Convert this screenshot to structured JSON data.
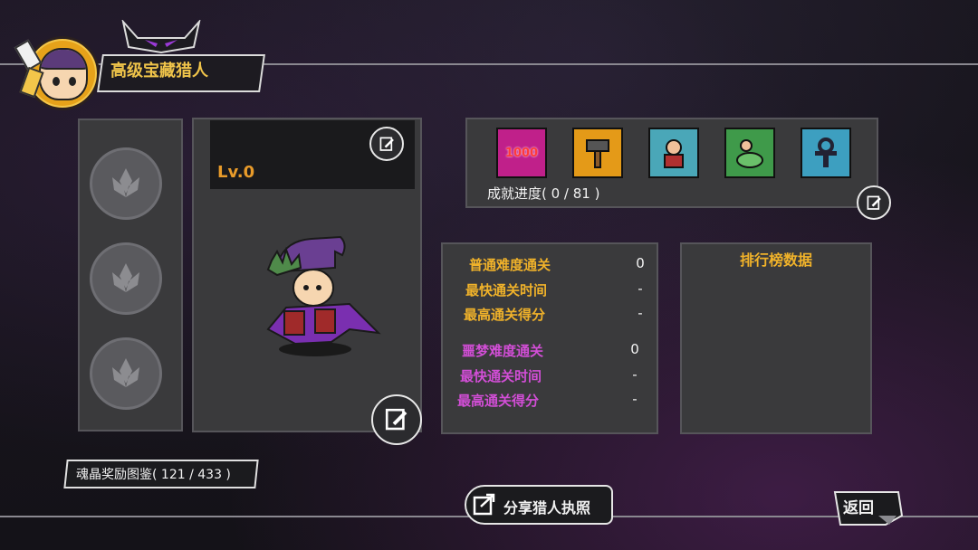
{
  "header": {
    "title": "高级宝藏猎人"
  },
  "character": {
    "level": "Lv.0"
  },
  "achievements": {
    "icons": [
      {
        "name": "1000-badge-icon",
        "label": "1000",
        "color": "#c0208a"
      },
      {
        "name": "hammer-icon",
        "label": "",
        "color": "#e49a18"
      },
      {
        "name": "fighter-icon",
        "label": "",
        "color": "#4aa7b8"
      },
      {
        "name": "dinosaur-rider-icon",
        "label": "",
        "color": "#3f9a4a"
      },
      {
        "name": "ankh-icon",
        "label": "",
        "color": "#3d9fc0"
      }
    ],
    "progress": "成就进度( 0 / 81 )"
  },
  "stats": {
    "normal": [
      {
        "label": "普通难度通关",
        "value": "0"
      },
      {
        "label": "最快通关时间",
        "value": "-"
      },
      {
        "label": "最高通关得分",
        "value": "-"
      }
    ],
    "nightmare": [
      {
        "label": "噩梦难度通关",
        "value": "0"
      },
      {
        "label": "最快通关时间",
        "value": "-"
      },
      {
        "label": "最高通关得分",
        "value": "-"
      }
    ]
  },
  "ranking": {
    "title": "排行榜数据"
  },
  "gallery": {
    "text": "魂晶奖励图鉴( 121 / 433 )"
  },
  "buttons": {
    "share": "分享猎人执照",
    "back": "返回"
  },
  "colors": {
    "accent_orange": "#f0b22a",
    "nightmare_purple": "#d24ed6",
    "level_orange": "#e89b2a"
  }
}
